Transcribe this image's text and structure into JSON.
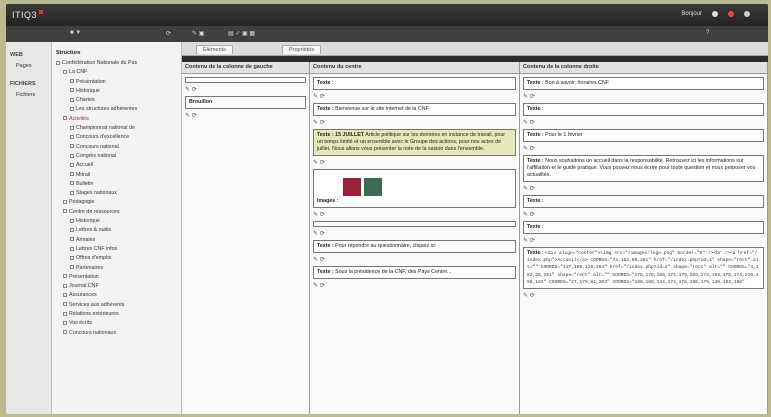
{
  "app": {
    "logo": "ITIQ3",
    "user_label": "Bonjour"
  },
  "left_nav": {
    "section1": "WEB",
    "items1": [
      "Pages"
    ],
    "section2": "FICHIERS",
    "items2": [
      "Fichiers"
    ]
  },
  "tree": {
    "header": "Structure",
    "nodes": [
      {
        "label": "Confédération Nationale du Pas",
        "depth": 0
      },
      {
        "label": "La CNF",
        "depth": 1
      },
      {
        "label": "Présentation",
        "depth": 2
      },
      {
        "label": "Historique",
        "depth": 2
      },
      {
        "label": "Chartes",
        "depth": 2
      },
      {
        "label": "Les structures adhérentes",
        "depth": 2
      },
      {
        "label": "Activités",
        "depth": 1,
        "red": true
      },
      {
        "label": "Championnat national de",
        "depth": 2
      },
      {
        "label": "Concours d'excellence",
        "depth": 2
      },
      {
        "label": "Concours national",
        "depth": 2
      },
      {
        "label": "Congrès national",
        "depth": 2
      },
      {
        "label": "Accueil",
        "depth": 2
      },
      {
        "label": "Mitrail",
        "depth": 2
      },
      {
        "label": "Bulletin",
        "depth": 2
      },
      {
        "label": "Stages nationaux",
        "depth": 2
      },
      {
        "label": "Pédagogie",
        "depth": 1
      },
      {
        "label": "Centre de ressources",
        "depth": 1
      },
      {
        "label": "Historique",
        "depth": 2
      },
      {
        "label": "Lettres & outils",
        "depth": 2
      },
      {
        "label": "Annales",
        "depth": 2
      },
      {
        "label": "Lettres CNF infos",
        "depth": 2
      },
      {
        "label": "Offres d'emploi",
        "depth": 2
      },
      {
        "label": "Partenaires",
        "depth": 2
      },
      {
        "label": "Présentation",
        "depth": 1
      },
      {
        "label": "Journal CNF",
        "depth": 1
      },
      {
        "label": "Assurances",
        "depth": 1
      },
      {
        "label": "Services aux adhérents",
        "depth": 1
      },
      {
        "label": "Relations extérieures",
        "depth": 1
      },
      {
        "label": "Vos écrits",
        "depth": 1
      },
      {
        "label": "Concours nationaux",
        "depth": 1
      }
    ]
  },
  "tabs": [
    "Éléments",
    "Propriétés"
  ],
  "columns": [
    {
      "header": "Contenu de la colonne de gauche",
      "cells": [
        {
          "label": "",
          "text": ""
        },
        {
          "label": "Brouillon",
          "text": ""
        }
      ]
    },
    {
      "header": "Contenu du centre",
      "cells": [
        {
          "label": "Texte :",
          "text": ""
        },
        {
          "label": "Texte :",
          "text": "Bienvenue sur le site internet de la CNF."
        },
        {
          "label": "Texte : 15 JUILLET",
          "text": "Article politique sur les données en instance de travail, pour un temps limité et un ensemble avec le Groupe des actions, pour nos actes de juillet. Nous allons vous présenter la note de la saison dans l'ensemble."
        },
        {
          "label": "Images :",
          "text": ""
        },
        {
          "label": "",
          "text": ""
        },
        {
          "label": "Texte :",
          "text": "Pour répondre au questionnaire, cliquez ici"
        },
        {
          "label": "Texte :",
          "text": "Sous la présidence de la CNF, des Pays Centre..."
        }
      ]
    },
    {
      "header": "Contenu de la colonne droite",
      "cells": [
        {
          "label": "Texte :",
          "text": "Bon à savoir: horaires CNF"
        },
        {
          "label": "Texte :",
          "text": ""
        },
        {
          "label": "Texte :",
          "text": "Pour le 1 février"
        },
        {
          "label": "Texte :",
          "text": "Nous souhaitons un accueil dans la responsabilité. Retrouvez ici les informations sur l'affiliation et le guide pratique. Vous pouvez nous écrire pour toute question et nous proposer vos actualités."
        },
        {
          "label": "Texte :",
          "text": ""
        },
        {
          "label": "Texte :",
          "text": ""
        },
        {
          "label": "Texte :",
          "text": "<div align=\"center\"><img src=\"/images/logo.png\" border=\"0\" /><br /><a href=\"/index.php\">Accueil</a> COORDS=\"74,182,89,201\" href=\"/index.php?id=1\" shape=\"rect\" alt=\"\" COORDS=\"117,189,126,204\" href=\"/index.php?id=2\" shape=\"rect\" alt=\"\" COORDS=\"4,182,26,201\" shape=\"rect\" alt=\"\" COORDS=\"178,178,189,174,179,209,174,193,179,174,210,198,183\" COORDS=\"27,179,81,203\" COORDS=\"188,189,134,174,178,198,179,139,193,198\""
        }
      ]
    }
  ]
}
